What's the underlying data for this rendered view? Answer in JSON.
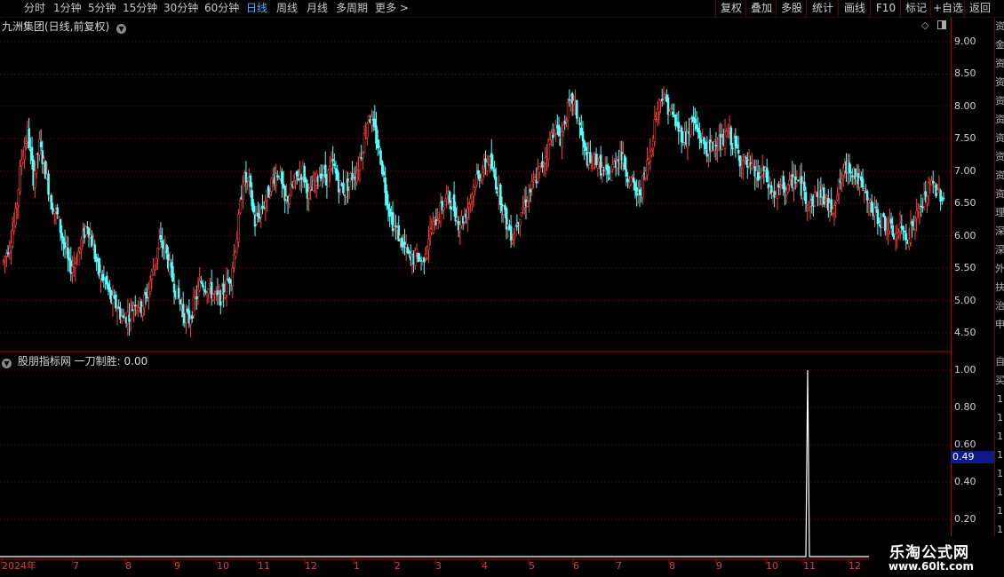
{
  "toolbar": {
    "periods": [
      "分时",
      "1分钟",
      "5分钟",
      "15分钟",
      "30分钟",
      "60分钟",
      "日线",
      "周线",
      "月线",
      "多周期",
      "更多 >"
    ],
    "active_period": "日线",
    "right_buttons": [
      "复权",
      "叠加",
      "多股",
      "统计",
      "画线",
      "F10",
      "标记",
      "+自选",
      "返回"
    ]
  },
  "main_chart": {
    "title": "九洲集团(日线,前复权)",
    "y_ticks": [
      "9.00",
      "8.50",
      "8.00",
      "7.50",
      "7.00",
      "6.50",
      "6.00",
      "5.50",
      "5.00",
      "4.50"
    ]
  },
  "indicator": {
    "title": "股朋指标网  一刀制胜: 0.00",
    "y_ticks": [
      "1.00",
      "0.80",
      "0.60",
      "0.40",
      "0.20"
    ],
    "current_value": "0.49"
  },
  "date_axis": {
    "labels": [
      "2024年",
      "7",
      "8",
      "9",
      "10",
      "11",
      "12",
      "1",
      "2",
      "3",
      "4",
      "5",
      "6",
      "7",
      "8",
      "9",
      "10",
      "11",
      "12"
    ]
  },
  "right_strip": {
    "top_chars": [
      "资",
      "金",
      "资",
      "资",
      "资",
      "资",
      "资",
      "资",
      "资",
      "资",
      "理",
      "深",
      "深",
      "外",
      "扶",
      "治",
      "申"
    ],
    "bottom_chars": [
      "自",
      "买",
      "1",
      "1",
      "1",
      "1",
      "1",
      "1",
      "1",
      "1",
      "1",
      "1",
      "1"
    ]
  },
  "watermark": {
    "title": "乐淘公式网",
    "url": "www.60lt.com"
  },
  "colors": {
    "up": "#ff3c3c",
    "down": "#54ffff",
    "grid": "#7a0000",
    "axis": "#b00000",
    "indicator_line": "#ffffff"
  },
  "chart_data": [
    {
      "type": "candlestick",
      "title": "九洲集团(日线,前复权)",
      "ylim": [
        4.4,
        9.2
      ],
      "closes": [
        5.6,
        5.9,
        6.3,
        7.2,
        7.6,
        6.9,
        7.4,
        7.0,
        6.5,
        6.3,
        5.9,
        5.5,
        5.6,
        5.9,
        6.2,
        5.8,
        5.4,
        5.3,
        5.0,
        4.9,
        4.7,
        4.8,
        5.0,
        4.9,
        5.1,
        5.5,
        5.9,
        5.8,
        5.4,
        5.1,
        4.8,
        4.7,
        5.0,
        5.3,
        5.2,
        5.1,
        5.0,
        5.2,
        5.4,
        6.0,
        6.9,
        6.8,
        6.2,
        6.4,
        6.6,
        6.9,
        7.0,
        6.5,
        6.7,
        6.9,
        7.0,
        6.6,
        6.8,
        7.0,
        6.9,
        7.1,
        6.8,
        6.7,
        6.9,
        7.0,
        7.4,
        7.9,
        7.6,
        7.2,
        6.6,
        6.2,
        6.0,
        5.8,
        5.6,
        5.7,
        5.6,
        6.0,
        6.2,
        6.4,
        6.6,
        6.5,
        6.2,
        6.3,
        6.6,
        6.9,
        7.0,
        7.2,
        6.9,
        6.6,
        6.2,
        6.0,
        6.3,
        6.5,
        6.7,
        6.9,
        7.1,
        7.4,
        7.7,
        7.5,
        7.9,
        8.1,
        7.8,
        7.3,
        7.1,
        7.2,
        7.0,
        6.9,
        7.1,
        7.3,
        7.0,
        6.8,
        6.6,
        6.9,
        7.3,
        7.9,
        8.2,
        8.0,
        7.8,
        7.6,
        7.5,
        7.8,
        7.6,
        7.4,
        7.3,
        7.5,
        7.4,
        7.6,
        7.4,
        7.2,
        7.1,
        7.0,
        6.9,
        7.0,
        6.7,
        6.6,
        6.8,
        6.7,
        6.9,
        6.8,
        6.6,
        6.5,
        6.7,
        6.6,
        6.4,
        6.6,
        6.9,
        7.1,
        7.0,
        6.8,
        6.6,
        6.4,
        6.3,
        6.2,
        6.1,
        6.0,
        6.1,
        6.0,
        6.2,
        6.4,
        6.6,
        6.8,
        6.7,
        6.6
      ]
    },
    {
      "type": "line",
      "title": "股朋指标网  一刀制胜: 0.00",
      "ylim": [
        0,
        1.1
      ],
      "series": [
        {
          "name": "一刀制胜",
          "values": "0 everywhere except a spike to 1.00 at the 11 (2025) date mark"
        }
      ]
    }
  ]
}
